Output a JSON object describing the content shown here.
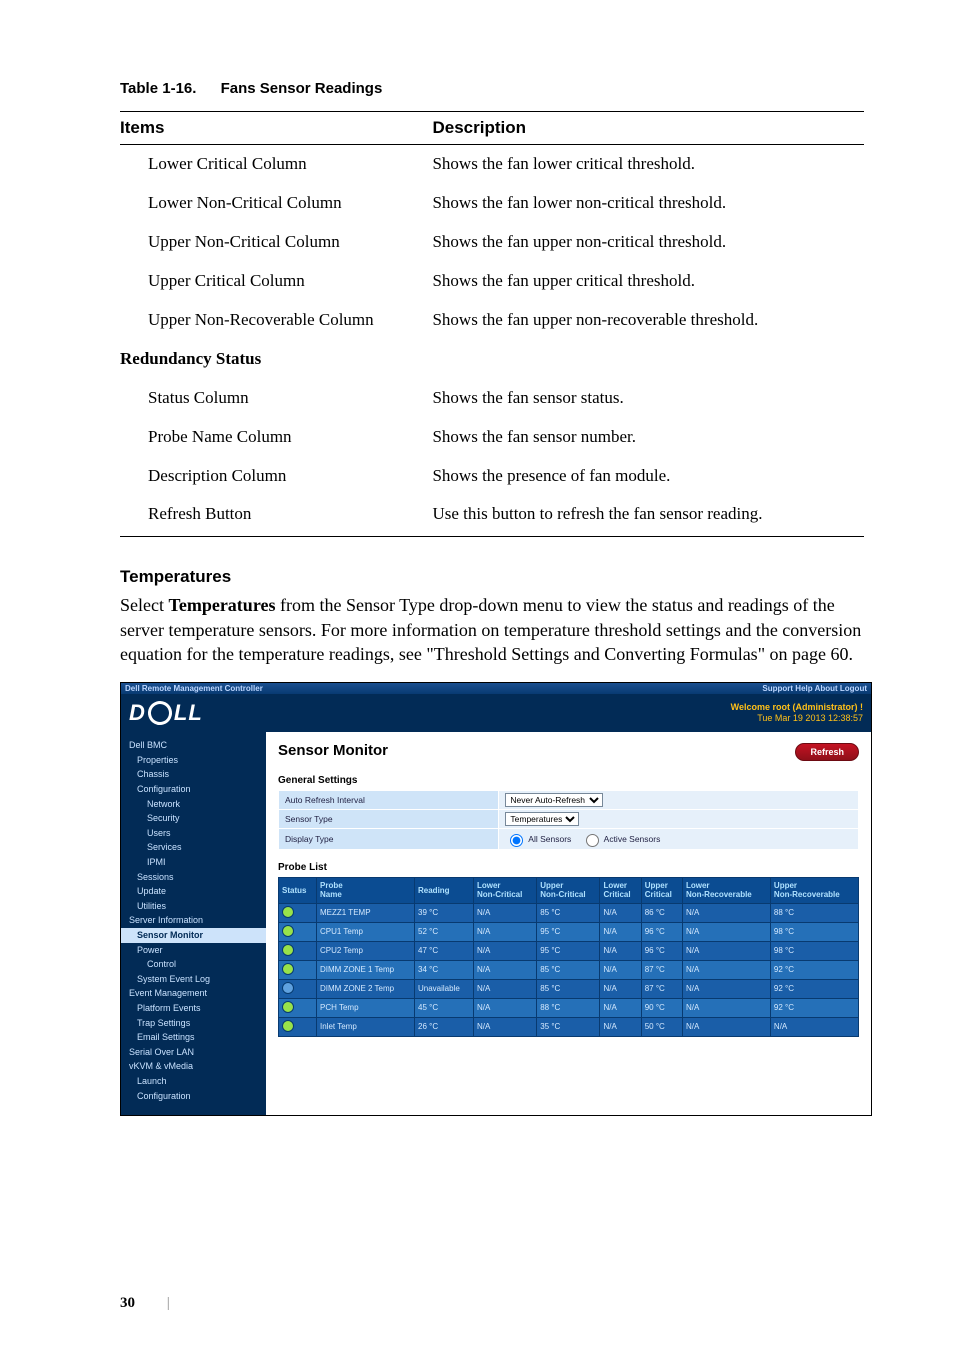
{
  "page_number": "30",
  "table_caption_num": "Table 1-16.",
  "table_caption_title": "Fans Sensor Readings",
  "th_items": "Items",
  "th_desc": "Description",
  "rows": [
    {
      "item": "Lower Critical Column",
      "desc": "Shows the fan lower critical threshold.",
      "indent": true
    },
    {
      "item": "Lower Non-Critical Column",
      "desc": "Shows the fan lower non-critical threshold.",
      "indent": true
    },
    {
      "item": "Upper Non-Critical Column",
      "desc": "Shows the fan upper non-critical threshold.",
      "indent": true
    },
    {
      "item": "Upper Critical Column",
      "desc": "Shows the fan upper critical threshold.",
      "indent": true
    },
    {
      "item": "Upper Non-Recoverable Column",
      "desc": "Shows the fan upper non-recoverable threshold.",
      "indent": true
    }
  ],
  "section_row": "Redundancy Status",
  "rows2": [
    {
      "item": "Status Column",
      "desc": "Shows the fan sensor status."
    },
    {
      "item": "Probe Name Column",
      "desc": "Shows the fan sensor number."
    },
    {
      "item": "Description Column",
      "desc": "Shows the presence of fan module."
    },
    {
      "item": "Refresh Button",
      "desc": "Use this button to refresh the fan sensor reading."
    }
  ],
  "sub_heading": "Temperatures",
  "body_paragraph_pre": "Select ",
  "body_paragraph_bold": "Temperatures",
  "body_paragraph_post": " from the Sensor Type drop-down menu to view the status and readings of the server temperature sensors. For more information on temperature threshold settings and the conversion equation for the temperature readings, see \"Threshold Settings and Converting Formulas\" on page 60.",
  "shot": {
    "topbar_left": "Dell Remote Management Controller",
    "topbar_right": "Support Help About Logout",
    "welcome_l1": "Welcome root (Administrator) !",
    "welcome_l2": "Tue Mar 19 2013 12:38:57",
    "title": "Sensor Monitor",
    "refresh": "Refresh",
    "section_gs": "General Settings",
    "section_probe": "Probe List",
    "gs_rows": [
      {
        "k": "Auto Refresh Interval",
        "v": "Never Auto-Refresh"
      },
      {
        "k": "Sensor Type",
        "v": "Temperatures"
      },
      {
        "k": "Display Type",
        "v": "All Sensors",
        "v2": "Active Sensors"
      }
    ],
    "sidebar": [
      {
        "t": "Dell BMC",
        "lvl": 0
      },
      {
        "t": "Properties",
        "lvl": 1
      },
      {
        "t": "Chassis",
        "lvl": 1
      },
      {
        "t": "Configuration",
        "lvl": 1
      },
      {
        "t": "Network",
        "lvl": 2
      },
      {
        "t": "Security",
        "lvl": 2
      },
      {
        "t": "Users",
        "lvl": 2
      },
      {
        "t": "Services",
        "lvl": 2
      },
      {
        "t": "IPMI",
        "lvl": 2
      },
      {
        "t": "Sessions",
        "lvl": 1
      },
      {
        "t": "Update",
        "lvl": 1
      },
      {
        "t": "Utilities",
        "lvl": 1
      },
      {
        "t": "Server Information",
        "lvl": 0
      },
      {
        "t": "Sensor Monitor",
        "lvl": 1,
        "sel": true
      },
      {
        "t": "Power",
        "lvl": 1
      },
      {
        "t": "Control",
        "lvl": 2
      },
      {
        "t": "System Event Log",
        "lvl": 1
      },
      {
        "t": "Event Management",
        "lvl": 0
      },
      {
        "t": "Platform Events",
        "lvl": 1
      },
      {
        "t": "Trap Settings",
        "lvl": 1
      },
      {
        "t": "Email Settings",
        "lvl": 1
      },
      {
        "t": "Serial Over LAN",
        "lvl": 0
      },
      {
        "t": "vKVM & vMedia",
        "lvl": 0
      },
      {
        "t": "Launch",
        "lvl": 1
      },
      {
        "t": "Configuration",
        "lvl": 1
      }
    ],
    "probe_headers": [
      "Status",
      "Probe Name",
      "Reading",
      "Lower Non-Critical",
      "Upper Non-Critical",
      "Lower Critical",
      "Upper Critical",
      "Lower Non-Recoverable",
      "Upper Non-Recoverable"
    ],
    "probe_rows": [
      {
        "s": "ok",
        "n": "MEZZ1 TEMP",
        "r": "39 °C",
        "lnc": "N/A",
        "unc": "85 °C",
        "lc": "N/A",
        "uc": "86 °C",
        "lnr": "N/A",
        "unr": "88 °C"
      },
      {
        "s": "ok",
        "n": "CPU1 Temp",
        "r": "52 °C",
        "lnc": "N/A",
        "unc": "95 °C",
        "lc": "N/A",
        "uc": "96 °C",
        "lnr": "N/A",
        "unr": "98 °C"
      },
      {
        "s": "ok",
        "n": "CPU2 Temp",
        "r": "47 °C",
        "lnc": "N/A",
        "unc": "95 °C",
        "lc": "N/A",
        "uc": "96 °C",
        "lnr": "N/A",
        "unr": "98 °C"
      },
      {
        "s": "ok",
        "n": "DIMM ZONE 1 Temp",
        "r": "34 °C",
        "lnc": "N/A",
        "unc": "85 °C",
        "lc": "N/A",
        "uc": "87 °C",
        "lnr": "N/A",
        "unr": "92 °C"
      },
      {
        "s": "un",
        "n": "DIMM ZONE 2 Temp",
        "r": "Unavailable",
        "lnc": "N/A",
        "unc": "85 °C",
        "lc": "N/A",
        "uc": "87 °C",
        "lnr": "N/A",
        "unr": "92 °C"
      },
      {
        "s": "ok",
        "n": "PCH Temp",
        "r": "45 °C",
        "lnc": "N/A",
        "unc": "88 °C",
        "lc": "N/A",
        "uc": "90 °C",
        "lnr": "N/A",
        "unr": "92 °C"
      },
      {
        "s": "ok",
        "n": "Inlet Temp",
        "r": "26 °C",
        "lnc": "N/A",
        "unc": "35 °C",
        "lc": "N/A",
        "uc": "50 °C",
        "lnr": "N/A",
        "unr": "N/A"
      }
    ]
  }
}
